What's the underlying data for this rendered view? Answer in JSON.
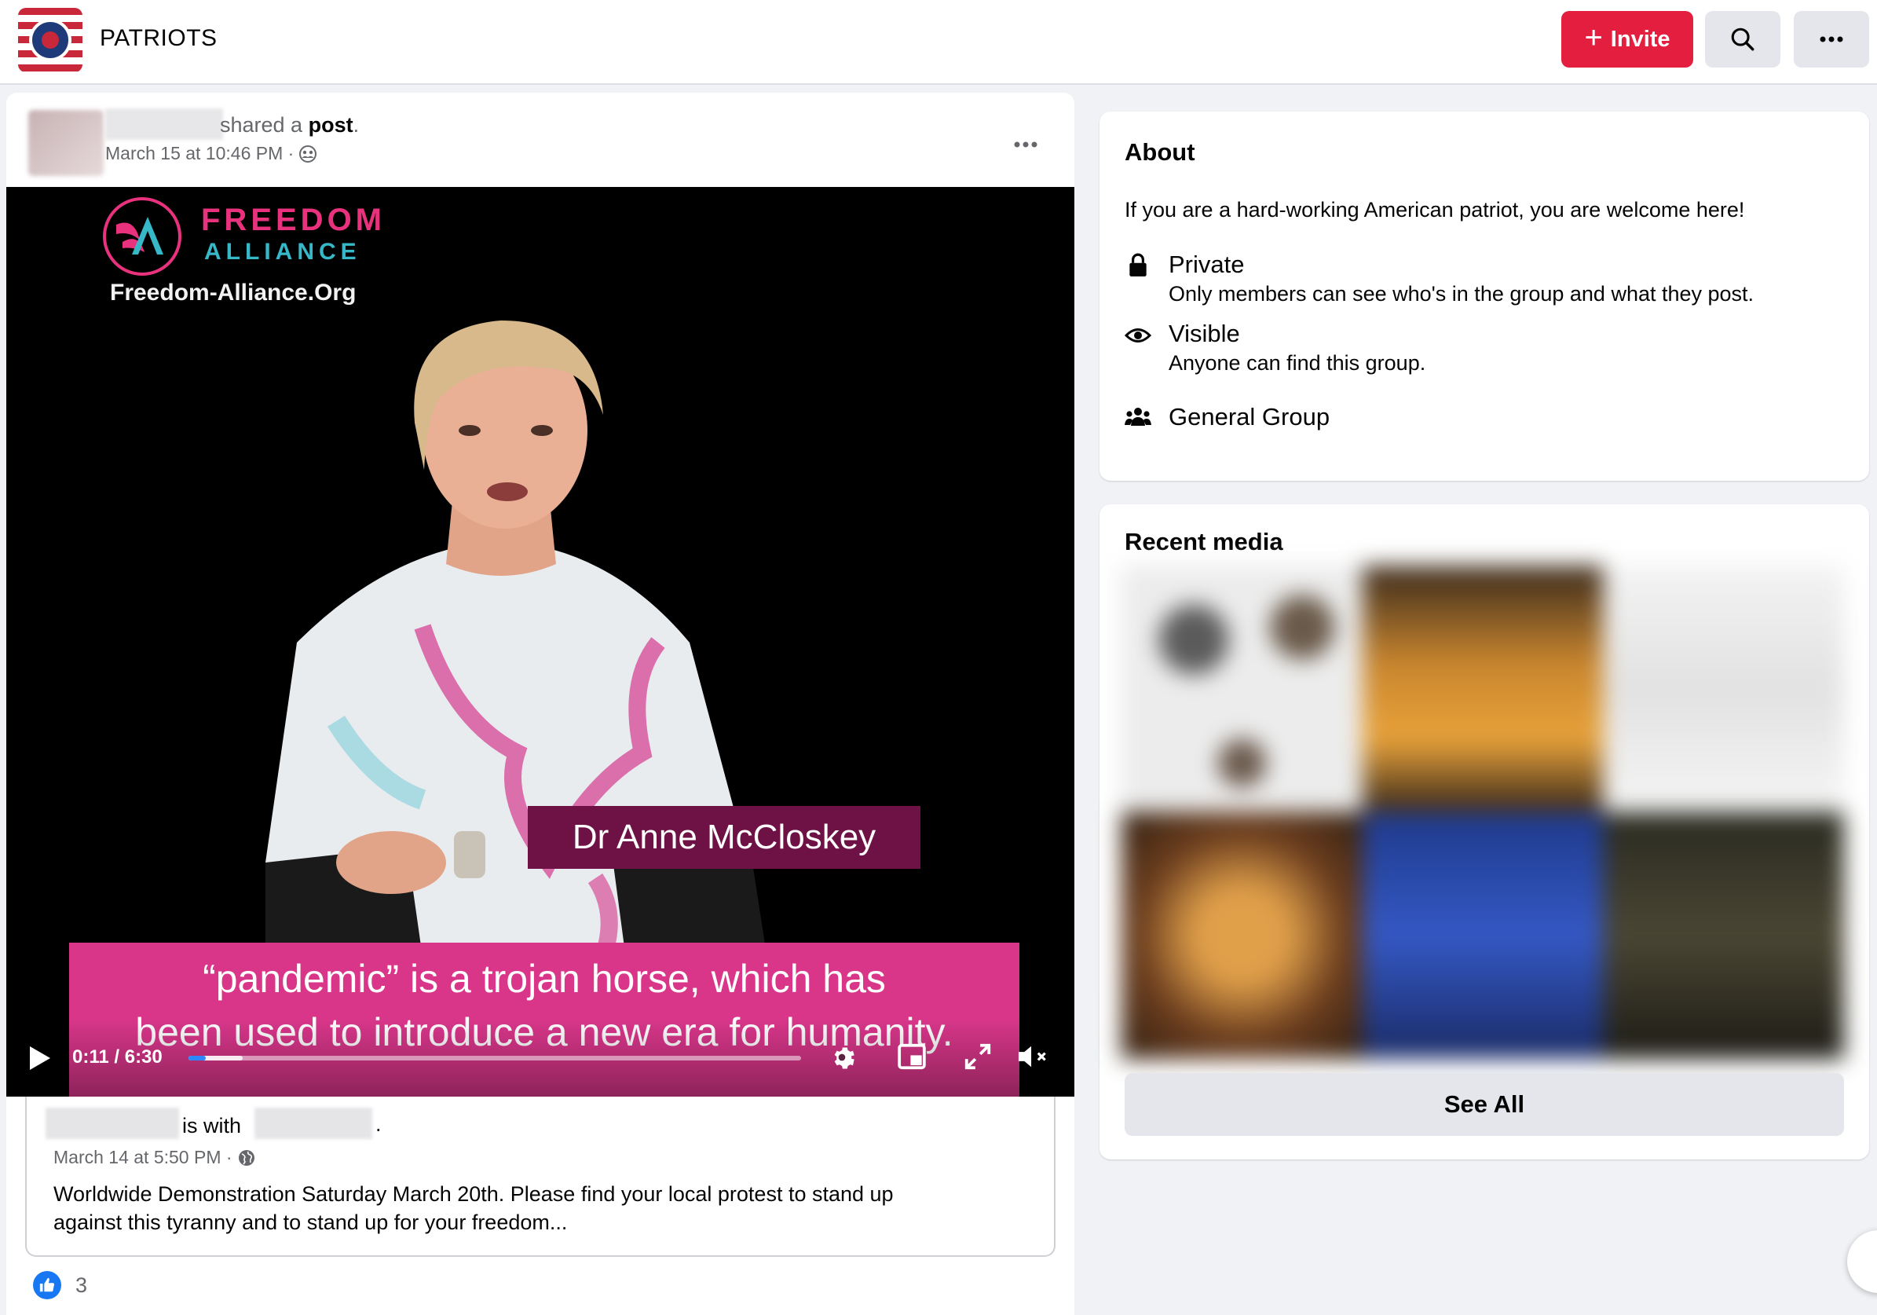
{
  "header": {
    "group_name": "PATRIOTS",
    "invite_label": "Invite",
    "icons": {
      "search": "search-icon",
      "more": "more-icon"
    }
  },
  "post": {
    "shared_prefix": "shared a ",
    "shared_link": "post",
    "shared_suffix": ".",
    "timestamp": "March 15 at 10:46 PM ·",
    "audience_icon": "group-icon",
    "video": {
      "brand_top": "FREEDOM",
      "brand_bottom": "ALLIANCE",
      "brand_url": "Freedom-Alliance.Org",
      "speaker_name": "Dr Anne McCloskey",
      "caption_line1": "“pandemic” is a trojan horse, which has",
      "caption_line2": "been used to introduce a new era for humanity.",
      "time_display": "0:11 / 6:30",
      "progress_fraction": 0.028,
      "buffered_fraction": 0.088
    },
    "original": {
      "is_with": "is with",
      "period": ".",
      "timestamp": "March 14 at 5:50 PM ·",
      "audience_icon": "globe-icon",
      "text_line1": "Worldwide Demonstration Saturday March 20th. Please find your local protest to stand up",
      "text_line2": "against this tyranny and to stand up for your freedom..."
    },
    "reactions": {
      "count": "3",
      "icon": "like-icon"
    }
  },
  "about": {
    "title": "About",
    "description": "If you are a hard-working American patriot, you are welcome here!",
    "privacy_title": "Private",
    "privacy_sub": "Only members can see who's in the group and what they post.",
    "visibility_title": "Visible",
    "visibility_sub": "Anyone can find this group.",
    "type_title": "General Group"
  },
  "recent_media": {
    "title": "Recent media",
    "see_all_label": "See All"
  },
  "colors": {
    "brand_red": "#e41e3f",
    "accent_blue": "#1877f2",
    "caption_pink": "#d9368a",
    "name_tag": "#6e1246"
  }
}
